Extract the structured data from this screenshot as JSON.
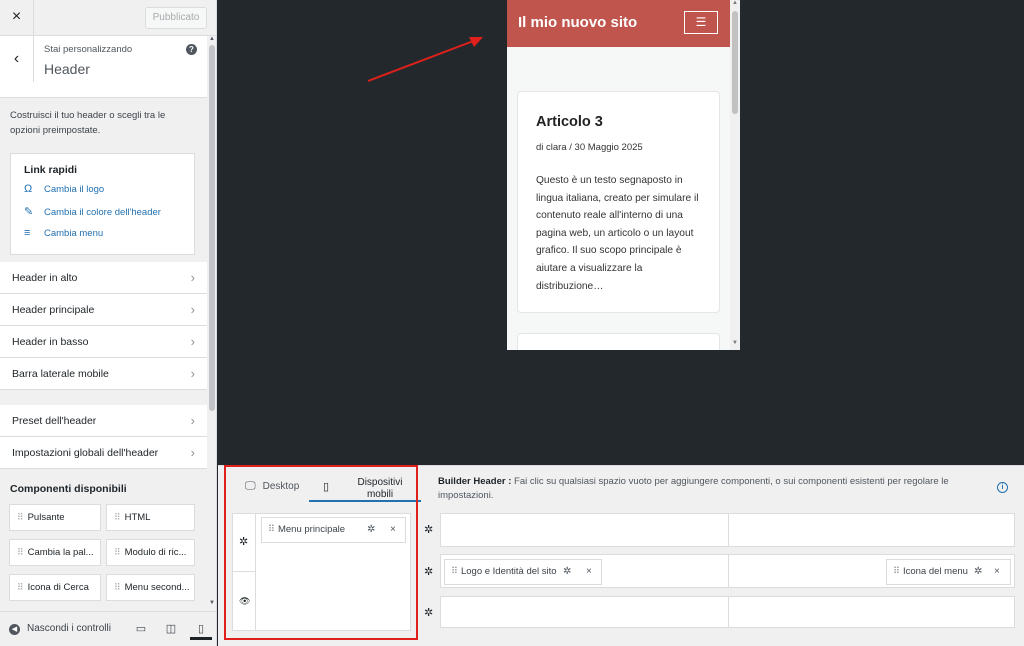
{
  "sidebar": {
    "close_icon": "×",
    "publish_label": "Pubblicato",
    "stai_label": "Stai personalizzando",
    "title": "Header",
    "description": "Costruisci il tuo header o scegli tra le opzioni preimpostate.",
    "quick_links": {
      "title": "Link rapidi",
      "items": [
        {
          "icon": "omega-icon",
          "label": "Cambia il logo"
        },
        {
          "icon": "brush-icon",
          "label": "Cambia il colore dell'header"
        },
        {
          "icon": "menu-icon",
          "label": "Cambia menu"
        }
      ]
    },
    "sections": [
      "Header in alto",
      "Header principale",
      "Header in basso",
      "Barra laterale mobile",
      "Preset dell'header",
      "Impostazioni globali dell'header"
    ],
    "components_title": "Componenti disponibili",
    "components": [
      "Pulsante",
      "HTML",
      "Cambia la pal...",
      "Modulo di ric...",
      "Icona di Cerca",
      "Menu second..."
    ],
    "hide_controls": "Nascondi i controlli"
  },
  "preview": {
    "site_title": "Il mio nuovo sito",
    "menu_icon": "☰",
    "post": {
      "title": "Articolo 3",
      "meta": "di clara  /  30 Maggio 2025",
      "excerpt": "Questo è un testo segnaposto in lingua italiana, creato per simulare il contenuto reale all'interno di una pagina web, un articolo o un layout grafico. Il suo scopo principale è aiutare a visualizzare la distribuzione…"
    }
  },
  "builder": {
    "tab_desktop": "Desktop",
    "tab_mobile": "Dispositivi mobili",
    "info_bold": "Builder Header :",
    "info_text": " Fai clic su qualsiasi spazio vuoto per aggiungere componenti, o sui componenti esistenti per regolare le impostazioni.",
    "mobile_panel_item": "Menu principale",
    "row_items": {
      "logo": "Logo e Identità del sito",
      "menu_icon": "Icona del menu"
    }
  },
  "colors": {
    "site_header": "#c0554e",
    "accent": "#2271b1",
    "highlight_box": "#e0201a",
    "annotation_arrow": "#e0201a"
  }
}
